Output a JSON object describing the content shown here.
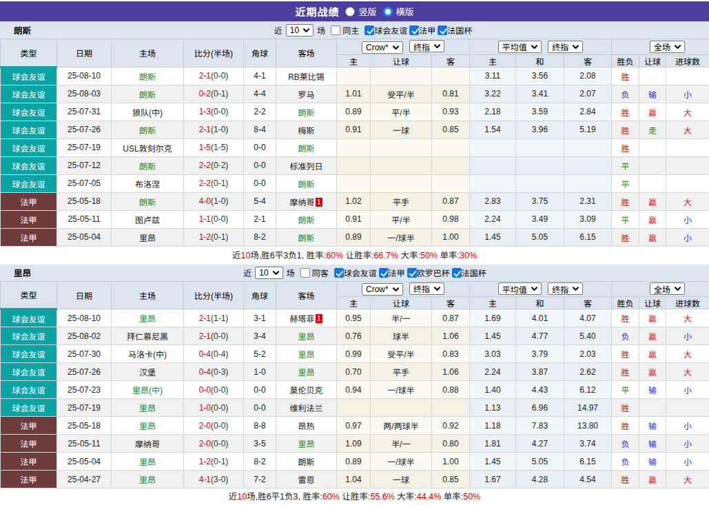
{
  "title_bar": {
    "title": "近期战绩",
    "radios": [
      {
        "label": "竖版",
        "checked": false
      },
      {
        "label": "横版",
        "checked": true
      }
    ]
  },
  "table_columns": {
    "main": [
      "类型",
      "日期",
      "主场",
      "比分(半场)",
      "角球",
      "客场"
    ],
    "groups": [
      {
        "selects": [
          "Crow*",
          "终指"
        ],
        "subs": [
          "主",
          "让球",
          "客"
        ]
      },
      {
        "selects": [
          "平均值",
          "终指"
        ],
        "subs": [
          "主",
          "和",
          "客"
        ]
      },
      {
        "selects": [
          "全场"
        ],
        "subs": [
          "胜负",
          "让球",
          "进球数"
        ]
      }
    ]
  },
  "palette": {
    "titlebar_bg": "#4c3e9e",
    "panel_bg": "#dce4ee",
    "friendly_bg": "#0ba3a3",
    "league_bg": "#6e3c3c",
    "team_green": "#1e8b1e",
    "score_red": "#e00000",
    "win_red": "#d02020",
    "lose_blue": "#3333cc",
    "draw_green": "#1e8b1e",
    "check_blue": "#0b76e8"
  },
  "teams": [
    {
      "name": "朗斯",
      "filter": {
        "prefix": "近",
        "count": "10",
        "suffix": "场",
        "same_label": "同主",
        "same_checked": false,
        "leagues": [
          {
            "label": "球会友谊",
            "checked": true
          },
          {
            "label": "法甲",
            "checked": true
          },
          {
            "label": "法国杯",
            "checked": true
          }
        ]
      },
      "rows": [
        {
          "lg": "球会友谊",
          "lgk": "friendly",
          "date": "25-08-10",
          "home": {
            "t": "朗斯",
            "hl": 1
          },
          "score": "2-1",
          "half": "(0-0)",
          "cor": "4-1",
          "away": {
            "t": "RB莱比锡"
          },
          "ah": [
            "",
            "",
            ""
          ],
          "eu": [
            "3.11",
            "3.56",
            "2.08"
          ],
          "res": [
            [
              "胜",
              "r"
            ],
            [
              "",
              ""
            ],
            [
              "",
              ""
            ]
          ]
        },
        {
          "lg": "球会友谊",
          "lgk": "friendly",
          "date": "25-08-03",
          "home": {
            "t": "朗斯",
            "hl": 1
          },
          "score": "0-2",
          "half": "(0-1)",
          "cor": "4-4",
          "away": {
            "t": "罗马"
          },
          "ah": [
            "1.01",
            "受平/半",
            "0.81"
          ],
          "eu": [
            "3.22",
            "3.41",
            "2.07"
          ],
          "res": [
            [
              "负",
              "b"
            ],
            [
              "输",
              "b"
            ],
            [
              "小",
              "b"
            ]
          ]
        },
        {
          "lg": "球会友谊",
          "lgk": "friendly",
          "date": "25-07-31",
          "home": {
            "t": "狼队(中)"
          },
          "score": "1-3",
          "half": "(0-0)",
          "cor": "2-2",
          "away": {
            "t": "朗斯",
            "hl": 1
          },
          "ah": [
            "0.89",
            "平/半",
            "0.93"
          ],
          "eu": [
            "2.18",
            "3.59",
            "2.84"
          ],
          "res": [
            [
              "胜",
              "r"
            ],
            [
              "赢",
              "r"
            ],
            [
              "大",
              "r"
            ]
          ]
        },
        {
          "lg": "球会友谊",
          "lgk": "friendly",
          "date": "25-07-26",
          "home": {
            "t": "朗斯",
            "hl": 1
          },
          "score": "2-1",
          "half": "(1-0)",
          "cor": "8-4",
          "away": {
            "t": "梅斯"
          },
          "ah": [
            "0.91",
            "一球",
            "0.85"
          ],
          "eu": [
            "1.54",
            "3.96",
            "5.19"
          ],
          "res": [
            [
              "胜",
              "r"
            ],
            [
              "走",
              "g"
            ],
            [
              "大",
              "r"
            ]
          ]
        },
        {
          "lg": "球会友谊",
          "lgk": "friendly",
          "date": "25-07-19",
          "home": {
            "t": "USL敦刻尔克"
          },
          "score": "1-5",
          "half": "(1-5)",
          "cor": "0-0",
          "away": {
            "t": "朗斯",
            "hl": 1
          },
          "ah": [
            "",
            "",
            ""
          ],
          "eu": [
            "",
            "",
            ""
          ],
          "res": [
            [
              "胜",
              "r"
            ],
            [
              "",
              ""
            ],
            [
              "",
              ""
            ]
          ]
        },
        {
          "lg": "球会友谊",
          "lgk": "friendly",
          "date": "25-07-12",
          "home": {
            "t": "朗斯",
            "hl": 1
          },
          "score": "2-2",
          "half": "(0-2)",
          "cor": "0-0",
          "away": {
            "t": "标准列日"
          },
          "ah": [
            "",
            "",
            ""
          ],
          "eu": [
            "",
            "",
            ""
          ],
          "res": [
            [
              "平",
              "g"
            ],
            [
              "",
              ""
            ],
            [
              "",
              ""
            ]
          ]
        },
        {
          "lg": "球会友谊",
          "lgk": "friendly",
          "date": "25-07-05",
          "home": {
            "t": "布洛涅"
          },
          "score": "2-2",
          "half": "(0-1)",
          "cor": "0-0",
          "away": {
            "t": "朗斯",
            "hl": 1
          },
          "ah": [
            "",
            "",
            ""
          ],
          "eu": [
            "",
            "",
            ""
          ],
          "res": [
            [
              "平",
              "g"
            ],
            [
              "",
              ""
            ],
            [
              "",
              ""
            ]
          ]
        },
        {
          "lg": "法甲",
          "lgk": "league",
          "date": "25-05-18",
          "home": {
            "t": "朗斯",
            "hl": 1
          },
          "score": "4-0",
          "half": "(1-0)",
          "cor": "5-4",
          "away": {
            "t": "摩纳哥",
            "rank": "1"
          },
          "ah": [
            "1.02",
            "平手",
            "0.87"
          ],
          "eu": [
            "2.83",
            "3.75",
            "2.31"
          ],
          "res": [
            [
              "胜",
              "r"
            ],
            [
              "赢",
              "r"
            ],
            [
              "大",
              "r"
            ]
          ]
        },
        {
          "lg": "法甲",
          "lgk": "league",
          "date": "25-05-11",
          "home": {
            "t": "图卢兹"
          },
          "score": "1-1",
          "half": "(0-0)",
          "cor": "2-1",
          "away": {
            "t": "朗斯",
            "hl": 1
          },
          "ah": [
            "0.91",
            "平/半",
            "0.98"
          ],
          "eu": [
            "2.24",
            "3.49",
            "3.09"
          ],
          "res": [
            [
              "平",
              "g"
            ],
            [
              "赢",
              "r"
            ],
            [
              "小",
              "b"
            ]
          ]
        },
        {
          "lg": "法甲",
          "lgk": "league",
          "date": "25-05-04",
          "home": {
            "t": "里昂"
          },
          "score": "1-2",
          "half": "(0-1)",
          "cor": "8-2",
          "away": {
            "t": "朗斯",
            "hl": 1
          },
          "ah": [
            "0.89",
            "一/球半",
            "1.00"
          ],
          "eu": [
            "1.45",
            "5.05",
            "6.15"
          ],
          "res": [
            [
              "胜",
              "r"
            ],
            [
              "赢",
              "r"
            ],
            [
              "小",
              "b"
            ]
          ]
        }
      ],
      "summary": [
        [
          "近",
          "k"
        ],
        [
          "10",
          "r"
        ],
        [
          "场,胜6平3负1, 胜率:",
          "k"
        ],
        [
          "60%",
          "r"
        ],
        [
          " 让胜率:",
          "k"
        ],
        [
          "66.7%",
          "r"
        ],
        [
          " 大率:",
          "k"
        ],
        [
          "50%",
          "r"
        ],
        [
          " 单率:",
          "k"
        ],
        [
          "30%",
          "r"
        ]
      ]
    },
    {
      "name": "里昂",
      "filter": {
        "prefix": "近",
        "count": "10",
        "suffix": "场",
        "same_label": "同客",
        "same_checked": false,
        "leagues": [
          {
            "label": "球会友谊",
            "checked": true
          },
          {
            "label": "法甲",
            "checked": true
          },
          {
            "label": "欧罗巴杯",
            "checked": true
          },
          {
            "label": "法国杯",
            "checked": true
          }
        ]
      },
      "rows": [
        {
          "lg": "球会友谊",
          "lgk": "friendly",
          "date": "25-08-10",
          "home": {
            "t": "里昂",
            "hl": 1
          },
          "score": "2-1",
          "half": "(1-1)",
          "cor": "3-1",
          "away": {
            "t": "赫塔菲",
            "rank": "1"
          },
          "ah": [
            "0.95",
            "半/一",
            "0.87"
          ],
          "eu": [
            "1.69",
            "4.01",
            "4.07"
          ],
          "res": [
            [
              "胜",
              "r"
            ],
            [
              "赢",
              "r"
            ],
            [
              "大",
              "r"
            ]
          ]
        },
        {
          "lg": "球会友谊",
          "lgk": "friendly",
          "date": "25-08-02",
          "home": {
            "t": "拜仁慕尼黑"
          },
          "score": "2-1",
          "half": "(0-0)",
          "cor": "3-4",
          "away": {
            "t": "里昂",
            "hl": 1
          },
          "ah": [
            "0.76",
            "球半",
            "1.06"
          ],
          "eu": [
            "1.45",
            "4.77",
            "5.40"
          ],
          "res": [
            [
              "负",
              "b"
            ],
            [
              "赢",
              "r"
            ],
            [
              "小",
              "b"
            ]
          ]
        },
        {
          "lg": "球会友谊",
          "lgk": "friendly",
          "date": "25-07-30",
          "home": {
            "t": "马洛卡(中)"
          },
          "score": "0-4",
          "half": "(0-4)",
          "cor": "5-2",
          "away": {
            "t": "里昂",
            "hl": 1
          },
          "ah": [
            "0.99",
            "受平/半",
            "0.83"
          ],
          "eu": [
            "3.03",
            "3.79",
            "2.03"
          ],
          "res": [
            [
              "胜",
              "r"
            ],
            [
              "赢",
              "r"
            ],
            [
              "大",
              "r"
            ]
          ]
        },
        {
          "lg": "球会友谊",
          "lgk": "friendly",
          "date": "25-07-26",
          "home": {
            "t": "汉堡"
          },
          "score": "0-4",
          "half": "(0-3)",
          "cor": "1-0",
          "away": {
            "t": "里昂",
            "hl": 1
          },
          "ah": [
            "0.70",
            "平手",
            "1.06"
          ],
          "eu": [
            "2.24",
            "3.87",
            "2.62"
          ],
          "res": [
            [
              "胜",
              "r"
            ],
            [
              "赢",
              "r"
            ],
            [
              "大",
              "r"
            ]
          ]
        },
        {
          "lg": "球会友谊",
          "lgk": "friendly",
          "date": "25-07-23",
          "home": {
            "t": "里昂(中)",
            "hl": 1
          },
          "score": "0-0",
          "half": "(0-0)",
          "cor": "0-0",
          "away": {
            "t": "莫伦贝克"
          },
          "ah": [
            "0.94",
            "一/球半",
            "0.88"
          ],
          "eu": [
            "1.40",
            "4.43",
            "6.12"
          ],
          "res": [
            [
              "平",
              "g"
            ],
            [
              "输",
              "b"
            ],
            [
              "小",
              "b"
            ]
          ]
        },
        {
          "lg": "球会友谊",
          "lgk": "friendly",
          "date": "25-07-19",
          "home": {
            "t": "里昂",
            "hl": 1
          },
          "score": "1-0",
          "half": "(0-0)",
          "cor": "0-0",
          "away": {
            "t": "维利法兰"
          },
          "ah": [
            "",
            "",
            ""
          ],
          "eu": [
            "1.13",
            "6.96",
            "14.97"
          ],
          "res": [
            [
              "胜",
              "r"
            ],
            [
              "",
              ""
            ],
            [
              "",
              ""
            ]
          ]
        },
        {
          "lg": "法甲",
          "lgk": "league",
          "date": "25-05-18",
          "home": {
            "t": "里昂",
            "hl": 1
          },
          "score": "2-0",
          "half": "(0-0)",
          "cor": "8-8",
          "away": {
            "t": "昂热"
          },
          "ah": [
            "0.97",
            "两/两球半",
            "0.92"
          ],
          "eu": [
            "1.18",
            "7.83",
            "13.80"
          ],
          "res": [
            [
              "胜",
              "r"
            ],
            [
              "输",
              "b"
            ],
            [
              "小",
              "b"
            ]
          ]
        },
        {
          "lg": "法甲",
          "lgk": "league",
          "date": "25-05-11",
          "home": {
            "t": "摩纳哥"
          },
          "score": "2-0",
          "half": "(0-0)",
          "cor": "3-5",
          "away": {
            "t": "里昂",
            "hl": 1
          },
          "ah": [
            "1.09",
            "半/一",
            "0.80"
          ],
          "eu": [
            "1.81",
            "4.27",
            "3.74"
          ],
          "res": [
            [
              "负",
              "b"
            ],
            [
              "输",
              "b"
            ],
            [
              "小",
              "b"
            ]
          ]
        },
        {
          "lg": "法甲",
          "lgk": "league",
          "date": "25-05-04",
          "home": {
            "t": "里昂",
            "hl": 1
          },
          "score": "1-2",
          "half": "(0-1)",
          "cor": "8-2",
          "away": {
            "t": "朗斯"
          },
          "ah": [
            "0.89",
            "一/球半",
            "1.00"
          ],
          "eu": [
            "1.45",
            "5.05",
            "6.15"
          ],
          "res": [
            [
              "负",
              "b"
            ],
            [
              "输",
              "b"
            ],
            [
              "小",
              "b"
            ]
          ]
        },
        {
          "lg": "法甲",
          "lgk": "league",
          "date": "25-04-27",
          "home": {
            "t": "里昂",
            "hl": 1
          },
          "score": "4-1",
          "half": "(3-0)",
          "cor": "7-2",
          "away": {
            "t": "雷恩"
          },
          "ah": [
            "1.04",
            "一球",
            "0.85"
          ],
          "eu": [
            "1.67",
            "4.28",
            "4.54"
          ],
          "res": [
            [
              "胜",
              "r"
            ],
            [
              "赢",
              "r"
            ],
            [
              "大",
              "r"
            ]
          ]
        }
      ],
      "summary": [
        [
          "近",
          "k"
        ],
        [
          "10",
          "r"
        ],
        [
          "场,胜6平1负3, 胜率:",
          "k"
        ],
        [
          "60%",
          "r"
        ],
        [
          " 让胜率:",
          "k"
        ],
        [
          "55.6%",
          "r"
        ],
        [
          " 大率:",
          "k"
        ],
        [
          "44.4%",
          "r"
        ],
        [
          " 单率:",
          "k"
        ],
        [
          "50%",
          "r"
        ]
      ]
    }
  ]
}
